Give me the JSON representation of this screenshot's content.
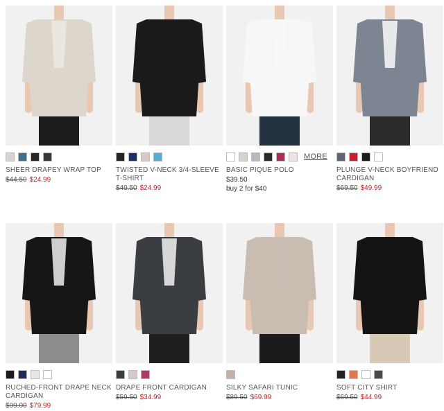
{
  "products": [
    {
      "name": "SHEER DRAPEY WRAP TOP",
      "was_price": "$44.50",
      "sale_price": "$24.99",
      "swatches": [
        "#dccfcf",
        "#3f6d8f",
        "#2a2522",
        "#34383f"
      ],
      "bg": "#f1f1f1",
      "top_color": "#ddd6cc",
      "bottom_color": "#1d1d1d",
      "inner_color": "#ece8e0"
    },
    {
      "name": "TWISTED V-NECK 3/4-SLEEVE T-SHIRT",
      "was_price": "$49.50",
      "sale_price": "$24.99",
      "swatches": [
        "#242424",
        "#1f2e66",
        "#d8c9c7",
        "#58acd8"
      ],
      "bg": "#f1f1f1",
      "top_color": "#1a1a1a",
      "bottom_color": "#d9d9d9",
      "inner_color": "#1a1a1a"
    },
    {
      "name": "BASIC PIQUE POLO",
      "regular_price": "$39.50",
      "promo": "buy 2 for $40",
      "more_label": "MORE",
      "swatches": [
        "#ffffff",
        "#dccfcb",
        "#b9b7c4",
        "#302a28",
        "#b02d52",
        "#f1dfe4"
      ],
      "bg": "#f1f1f1",
      "top_color": "#f7f7f7",
      "bottom_color": "#243241",
      "inner_color": "#f7f7f7"
    },
    {
      "name": "PLUNGE V-NECK BOYFRIEND CARDIGAN",
      "was_price": "$69.50",
      "sale_price": "$49.99",
      "swatches": [
        "#5e6673",
        "#c8202f",
        "#1d1d1d",
        "#ffffff"
      ],
      "bg": "#f1f1f1",
      "top_color": "#7d8592",
      "bottom_color": "#2b2b2b",
      "inner_color": "#f4f4f4"
    },
    {
      "name": "RUCHED-FRONT DRAPE NECK CARDIGAN",
      "was_price": "$99.00",
      "sale_price": "$79.99",
      "swatches": [
        "#1c1c1c",
        "#1f2d5c",
        "#e6e6ee",
        "#ffffff"
      ],
      "bg": "#f1f1f1",
      "top_color": "#161616",
      "bottom_color": "#8c8c8c",
      "inner_color": "#e2e2e2"
    },
    {
      "name": "DRAPE FRONT CARDIGAN",
      "was_price": "$59.50",
      "sale_price": "$34.99",
      "swatches": [
        "#383c44",
        "#d6c9c7",
        "#b03a66"
      ],
      "bg": "#f1f1f1",
      "top_color": "#3a3d42",
      "bottom_color": "#1f1f1f",
      "inner_color": "#e8e8e8"
    },
    {
      "name": "SILKY SAFARI TUNIC",
      "was_price": "$89.50",
      "sale_price": "$69.99",
      "swatches": [
        "#c4b0a8"
      ],
      "bg": "#f1f1f1",
      "top_color": "#c9bdb2",
      "bottom_color": "#1b1b1b",
      "inner_color": "#c9bdb2"
    },
    {
      "name": "SOFT CITY SHIRT",
      "was_price": "$69.50",
      "sale_price": "$44.99",
      "swatches": [
        "#232323",
        "#e6754f",
        "#ffffff",
        "#4a4a4a"
      ],
      "bg": "#f1f1f1",
      "top_color": "#141414",
      "bottom_color": "#d8c9b6",
      "inner_color": "#141414"
    }
  ]
}
